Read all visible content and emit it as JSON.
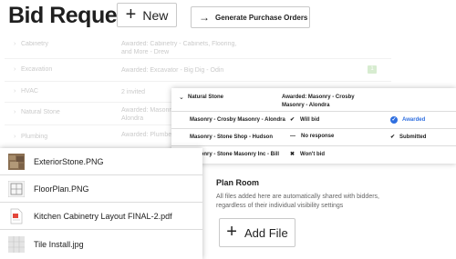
{
  "header": {
    "title": "Bid Requests",
    "new_label": "New",
    "generate_label": "Generate Purchase Orders"
  },
  "background_rows": [
    {
      "name": "Cabinetry",
      "award": "Awarded: Cabinetry - Cabinets, Flooring, and More - Drew",
      "badge": ""
    },
    {
      "name": "Excavation",
      "award": "Awarded: Excavator - Big Dig - Odin",
      "badge": "1"
    },
    {
      "name": "HVAC",
      "award": "2 invited",
      "badge": ""
    },
    {
      "name": "Natural Stone",
      "award": "Awarded: Masonry - Crosby Masonry - Alondra",
      "badge": ""
    },
    {
      "name": "Plumbing",
      "award": "Awarded: Plumber - Jackson",
      "badge": ""
    }
  ],
  "stone_panel": {
    "name": "Natural Stone",
    "award": "Awarded: Masonry - Crosby Masonry - Alondra",
    "rows": [
      {
        "vendor": "Masonry - Crosby Masonry - Alondra",
        "status_icon": "check-icon",
        "status": "Will bid",
        "outcome_icon": "check-circle-icon",
        "outcome": "Awarded"
      },
      {
        "vendor": "Masonry - Stone Shop - Hudson",
        "status_icon": "dash-icon",
        "status": "No response",
        "outcome_icon": "check-icon",
        "outcome": "Submitted"
      },
      {
        "vendor": "Masonry - Stone Masonry Inc - Bill",
        "status_icon": "x-icon",
        "status": "Won't bid",
        "outcome_icon": "",
        "outcome": ""
      }
    ]
  },
  "files": [
    {
      "name": "ExteriorStone.PNG",
      "icon": "image-thumbnail-icon"
    },
    {
      "name": "FloorPlan.PNG",
      "icon": "blueprint-thumbnail-icon"
    },
    {
      "name": "Kitchen Cabinetry Layout FINAL-2.pdf",
      "icon": "pdf-file-icon"
    },
    {
      "name": "Tile Install.jpg",
      "icon": "tile-thumbnail-icon"
    }
  ],
  "plan_room": {
    "title": "Plan Room",
    "description": "All files added here are automatically shared with bidders, regardless of their individual visibility settings",
    "add_label": "Add File"
  },
  "colors": {
    "accent": "#2f6fe0",
    "badge_green": "#8fca7b"
  }
}
